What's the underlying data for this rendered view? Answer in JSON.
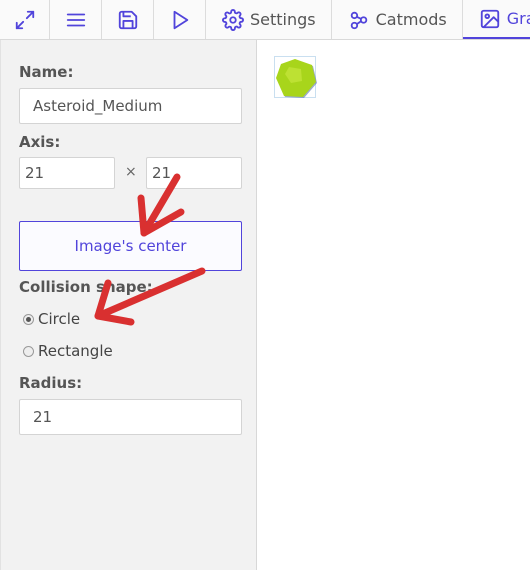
{
  "toolbar": {
    "icons": [
      "fullscreen-icon",
      "menu-icon",
      "save-icon",
      "play-icon"
    ],
    "tabs": [
      {
        "label": "Settings",
        "icon": "gear-icon"
      },
      {
        "label": "Catmods",
        "icon": "share-nodes-icon"
      },
      {
        "label": "Gra",
        "icon": "image-icon",
        "active": true
      }
    ]
  },
  "form": {
    "name_label": "Name:",
    "name_value": "Asteroid_Medium",
    "axis_label": "Axis:",
    "axis_x": "21",
    "axis_separator": "×",
    "axis_y": "21",
    "center_button": "Image's center",
    "collision_label": "Collision shape:",
    "shapes": [
      {
        "label": "Circle",
        "checked": true
      },
      {
        "label": "Rectangle",
        "checked": false
      }
    ],
    "radius_label": "Radius:",
    "radius_value": "21"
  },
  "colors": {
    "accent": "#5144db",
    "annotation_arrow": "#d93030",
    "sprite_fill": "#a8d51b"
  }
}
